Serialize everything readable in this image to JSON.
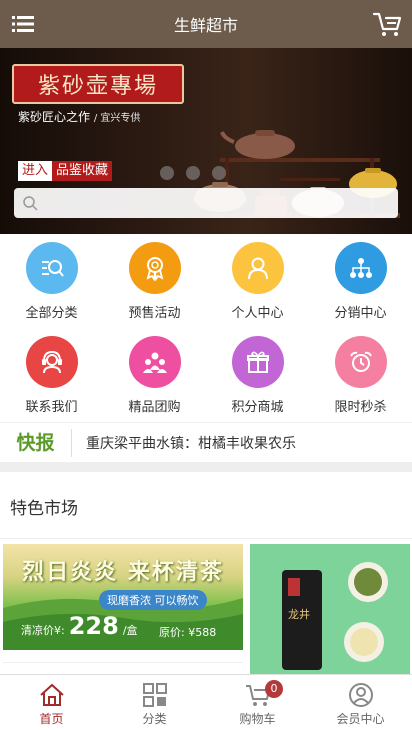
{
  "header": {
    "title": "生鲜超市"
  },
  "banner": {
    "title": "紫砂壶專場",
    "subtitle": "紫砂匠心之作",
    "subtitle_small": "/ 宜兴专供",
    "cta_left": "进入",
    "cta_right": "品鉴收藏",
    "slide_count": 3
  },
  "search": {
    "placeholder": ""
  },
  "nav_icons": [
    {
      "label": "全部分类",
      "color": "#5bb9f0",
      "icon": "search-list-icon"
    },
    {
      "label": "预售活动",
      "color": "#f39c12",
      "icon": "award-icon"
    },
    {
      "label": "个人中心",
      "color": "#fcc43e",
      "icon": "user-icon"
    },
    {
      "label": "分销中心",
      "color": "#2f9be0",
      "icon": "network-icon"
    },
    {
      "label": "联系我们",
      "color": "#e84545",
      "icon": "headset-icon"
    },
    {
      "label": "精品团购",
      "color": "#ef4fa0",
      "icon": "group-icon"
    },
    {
      "label": "积分商城",
      "color": "#c266d6",
      "icon": "gift-icon"
    },
    {
      "label": "限时秒杀",
      "color": "#f47fa0",
      "icon": "alarm-clock-icon"
    }
  ],
  "news": {
    "tag": "快报",
    "text": "重庆梁平曲水镇：柑橘丰收果农乐"
  },
  "section": {
    "title": "特色市场"
  },
  "promo1": {
    "headline": "烈日炎炎  来杯清茶",
    "pill": "现磨香浓 可以畅饮",
    "price_label": "清凉价¥:",
    "price": "228",
    "price_unit": "/盒",
    "original": "原价:  ¥588"
  },
  "promo2": {
    "can_label": "龙井"
  },
  "tabbar": {
    "tabs": [
      {
        "label": "首页",
        "icon": "home-icon"
      },
      {
        "label": "分类",
        "icon": "grid-icon"
      },
      {
        "label": "购物车",
        "icon": "cart-icon"
      },
      {
        "label": "会员中心",
        "icon": "member-icon"
      }
    ],
    "cart_badge": "0"
  },
  "colors": {
    "header": "#6d5b4c",
    "accent": "#a52a2a",
    "news_tag": "#5a9a28"
  }
}
